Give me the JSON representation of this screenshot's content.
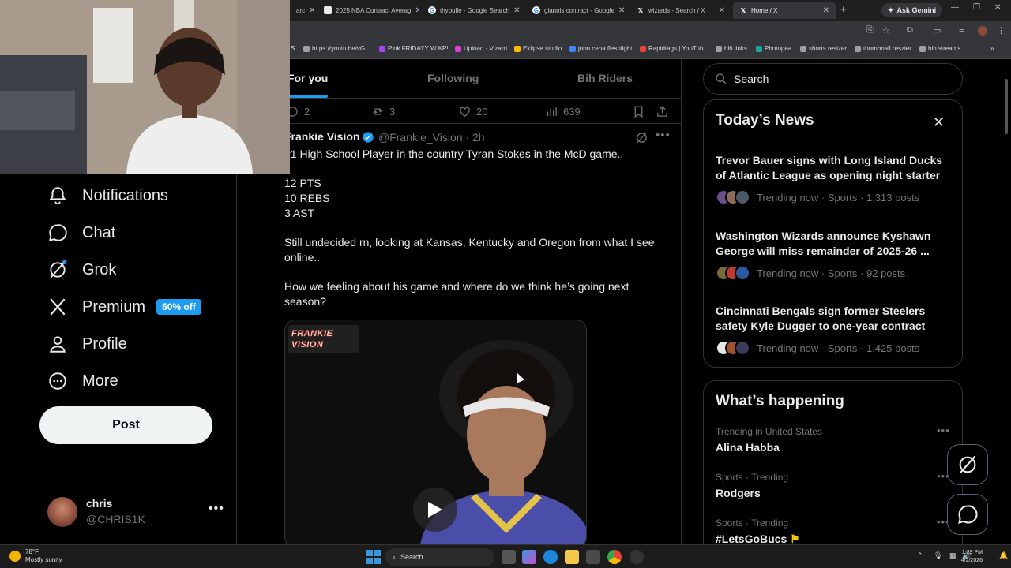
{
  "browser": {
    "tabs": [
      {
        "title": "arc",
        "favicon_color": "#5f6368"
      },
      {
        "title": "2025 NBA Contract Averag",
        "favicon_color": "#e8eaed"
      },
      {
        "title": "thybulle - Google Search",
        "favicon_color": "#4285f4"
      },
      {
        "title": "giannis contract - Google",
        "favicon_color": "#4285f4"
      },
      {
        "title": "wizards - Search / X",
        "favicon_color": "#000000"
      },
      {
        "title": "Home / X",
        "favicon_color": "#000000"
      }
    ],
    "new_tab": "+",
    "ask_gemini": "Ask Gemini",
    "bookmarks": [
      {
        "label": "S",
        "color": "#8ab4f8"
      },
      {
        "label": "https://youtu.be/vG...",
        "color": "#9aa0a6"
      },
      {
        "label": "Pink FRIDAYY W KP!...",
        "color": "#a142f4"
      },
      {
        "label": "Upload - Vizard",
        "color": "#d93fd9"
      },
      {
        "label": "Eklipse studio",
        "color": "#fbbc04"
      },
      {
        "label": "john cena fleshlight",
        "color": "#4285f4"
      },
      {
        "label": "Rapidtags | YouTub...",
        "color": "#ea4335"
      },
      {
        "label": "bih links",
        "color": "#9aa0a6"
      },
      {
        "label": "Photopea",
        "color": "#18a497"
      },
      {
        "label": "shorts resizer",
        "color": "#9aa0a6"
      },
      {
        "label": "thumbnail reszier",
        "color": "#9aa0a6"
      },
      {
        "label": "bih streams",
        "color": "#9aa0a6"
      }
    ]
  },
  "sidebar": {
    "items": [
      {
        "label": "Notifications"
      },
      {
        "label": "Chat"
      },
      {
        "label": "Grok"
      },
      {
        "label": "Premium",
        "badge": "50% off"
      },
      {
        "label": "Profile"
      },
      {
        "label": "More"
      }
    ],
    "post_button": "Post",
    "account": {
      "name": "chris",
      "handle": "@CHRIS1K"
    }
  },
  "feed": {
    "tabs": [
      "For you",
      "Following",
      "Bih Riders"
    ],
    "prev_actions": {
      "replies": "2",
      "reposts": "3",
      "likes": "20",
      "views": "639"
    },
    "tweet": {
      "author": "Frankie Vision",
      "handle": "@Frankie_Vision",
      "time": "· 2h",
      "lines": [
        "#1 High School Player in the country Tyran Stokes in the McD game..",
        "12 PTS",
        "10 REBS",
        "3 AST",
        "Still undecided rn, looking at Kansas, Kentucky and Oregon from what I see",
        "online..",
        "How we feeling about his game and where do we think he’s going next",
        "season?"
      ],
      "media_watermark": "FRANKIE VISION"
    }
  },
  "right": {
    "search_placeholder": "Search",
    "news": {
      "title": "Today’s News",
      "items": [
        {
          "headline": "Trevor Bauer signs with Long Island Ducks of Atlantic League as opening night starter",
          "meta": "Trending now · Sports · 1,313 posts"
        },
        {
          "headline": "Washington Wizards announce Kyshawn George will miss remainder of 2025-26 ...",
          "meta": "Trending now · Sports · 92 posts"
        },
        {
          "headline": "Cincinnati Bengals sign former Steelers safety Kyle Dugger to one-year contract",
          "meta": "Trending now · Sports · 1,425 posts"
        }
      ]
    },
    "happening": {
      "title": "What’s happening",
      "items": [
        {
          "context": "Trending in United States",
          "topic": "Alina Habba"
        },
        {
          "context": "Sports · Trending",
          "topic": "Rodgers"
        },
        {
          "context": "Sports · Trending",
          "topic": "#LetsGoBucs"
        }
      ]
    }
  },
  "taskbar": {
    "weather_temp": "78°F",
    "weather_desc": "Mostly sunny",
    "search": "Search",
    "time": "1:29 PM",
    "date": "4/2/2026"
  }
}
